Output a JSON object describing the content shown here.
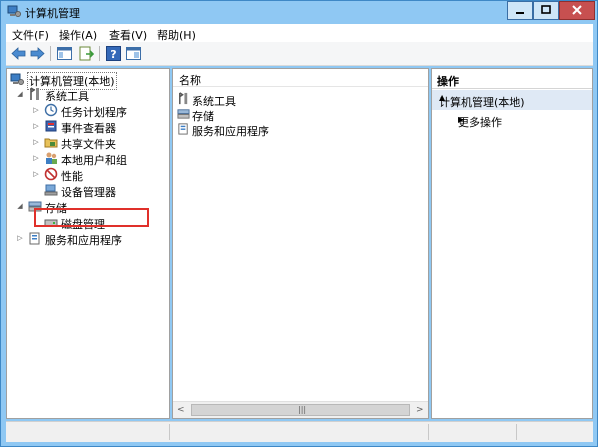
{
  "window": {
    "title": "计算机管理"
  },
  "menu": [
    {
      "label": "文件(F)"
    },
    {
      "label": "操作(A)"
    },
    {
      "label": "查看(V)"
    },
    {
      "label": "帮助(H)"
    }
  ],
  "tree": {
    "root": "计算机管理(本地)",
    "system_tools": "系统工具",
    "task_scheduler": "任务计划程序",
    "event_viewer": "事件查看器",
    "shared_folders": "共享文件夹",
    "local_users": "本地用户和组",
    "performance": "性能",
    "device_manager": "设备管理器",
    "storage": "存储",
    "disk_management": "磁盘管理",
    "services": "服务和应用程序"
  },
  "list": {
    "column_name": "名称",
    "items": [
      {
        "label": "系统工具",
        "icon": "tools-icon"
      },
      {
        "label": "存储",
        "icon": "storage-icon"
      },
      {
        "label": "服务和应用程序",
        "icon": "services-icon"
      }
    ]
  },
  "actions": {
    "header": "操作",
    "section": "计算机管理(本地)",
    "more": "更多操作"
  },
  "colors": {
    "titlebar": "#8fc8f3",
    "close_button": "#c75050",
    "highlight_box": "#e0302a",
    "selected_section": "#dfe9f5"
  }
}
